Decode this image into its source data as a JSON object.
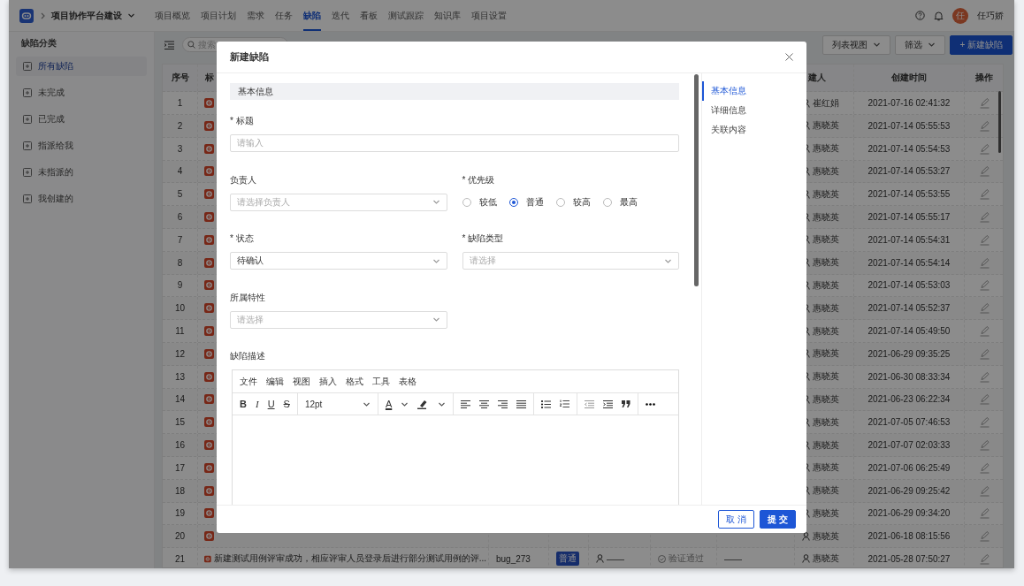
{
  "project": {
    "name": "项目协作平台建设"
  },
  "nav": [
    {
      "label": "项目概览",
      "selected": false
    },
    {
      "label": "项目计划",
      "selected": false
    },
    {
      "label": "需求",
      "selected": false
    },
    {
      "label": "任务",
      "selected": false
    },
    {
      "label": "缺陷",
      "selected": true
    },
    {
      "label": "迭代",
      "selected": false
    },
    {
      "label": "看板",
      "selected": false
    },
    {
      "label": "测试跟踪",
      "selected": false
    },
    {
      "label": "知识库",
      "selected": false
    },
    {
      "label": "项目设置",
      "selected": false
    }
  ],
  "user": {
    "avatar": "任",
    "name": "任巧娇"
  },
  "sidebar": {
    "title": "缺陷分类",
    "items": [
      {
        "label": "所有缺陷",
        "selected": true
      },
      {
        "label": "未完成",
        "selected": false
      },
      {
        "label": "已完成",
        "selected": false
      },
      {
        "label": "指派给我",
        "selected": false
      },
      {
        "label": "未指派的",
        "selected": false
      },
      {
        "label": "我创建的",
        "selected": false
      }
    ]
  },
  "toolbar": {
    "search_placeholder": "搜索",
    "buttons": [
      {
        "label": "列表视图",
        "kind": "dropdown"
      },
      {
        "label": "筛选",
        "kind": "dropdown"
      },
      {
        "label": "+ 新建缺陷",
        "kind": "primary"
      }
    ]
  },
  "table": {
    "columns": {
      "index": "序号",
      "title": "标",
      "creator": "建人",
      "created": "创建时间",
      "actions": "操作"
    },
    "rows": [
      {
        "index": "1",
        "creator": "崔红娟",
        "created": "2021-07-16 02:41:32"
      },
      {
        "index": "2",
        "creator": "惠晓英",
        "created": "2021-07-14 05:55:53"
      },
      {
        "index": "3",
        "creator": "惠晓英",
        "created": "2021-07-14 05:54:53"
      },
      {
        "index": "4",
        "creator": "惠晓英",
        "created": "2021-07-14 05:53:27"
      },
      {
        "index": "5",
        "creator": "惠晓英",
        "created": "2021-07-14 05:53:55"
      },
      {
        "index": "6",
        "creator": "惠晓英",
        "created": "2021-07-14 05:55:17"
      },
      {
        "index": "7",
        "creator": "惠晓英",
        "created": "2021-07-14 05:54:31"
      },
      {
        "index": "8",
        "creator": "惠晓英",
        "created": "2021-07-14 05:54:14"
      },
      {
        "index": "9",
        "creator": "惠晓英",
        "created": "2021-07-14 05:53:03"
      },
      {
        "index": "10",
        "creator": "惠晓英",
        "created": "2021-07-14 05:52:37"
      },
      {
        "index": "11",
        "creator": "惠晓英",
        "created": "2021-07-14 05:49:50"
      },
      {
        "index": "12",
        "creator": "惠晓英",
        "created": "2021-06-29 09:35:25"
      },
      {
        "index": "13",
        "creator": "惠晓英",
        "created": "2021-06-30 08:33:34"
      },
      {
        "index": "14",
        "creator": "惠晓英",
        "created": "2021-06-23 06:22:34"
      },
      {
        "index": "15",
        "creator": "惠晓英",
        "created": "2021-07-05 07:46:53"
      },
      {
        "index": "16",
        "creator": "惠晓英",
        "created": "2021-07-07 02:03:33"
      },
      {
        "index": "17",
        "creator": "惠晓英",
        "created": "2021-07-06 06:25:49"
      },
      {
        "index": "18",
        "creator": "惠晓英",
        "created": "2021-06-29 09:25:42"
      },
      {
        "index": "19",
        "creator": "惠晓英",
        "created": "2021-06-29 09:34:20"
      },
      {
        "index": "20",
        "creator": "惠晓英",
        "created": "2021-06-18 08:15:56"
      },
      {
        "index": "21",
        "title": "新建测试用例评审成功，相应评审人员登录后进行部分测试用例的评...",
        "id": "bug_273",
        "priority": "普通",
        "assignee": "——",
        "status": "验证通过",
        "column_8": "——",
        "creator": "惠晓英",
        "created": "2021-05-28 07:50:27"
      }
    ]
  },
  "modal": {
    "title": "新建缺陷",
    "section": "基本信息",
    "fields": [
      {
        "kind": "text",
        "label": "* 标题",
        "placeholder": "请输入"
      },
      {
        "kind": "select",
        "label": "负责人",
        "placeholder": "请选择负责人"
      },
      {
        "kind": "radio",
        "label": "* 优先级",
        "options": [
          {
            "label": "较低",
            "selected": false
          },
          {
            "label": "普通",
            "selected": true
          },
          {
            "label": "较高",
            "selected": false
          },
          {
            "label": "最高",
            "selected": false
          }
        ]
      },
      {
        "kind": "select",
        "label": "* 状态",
        "value": "待确认"
      },
      {
        "kind": "select",
        "label": "* 缺陷类型",
        "placeholder": "请选择"
      },
      {
        "kind": "select",
        "label": "所属特性",
        "placeholder": "请选择"
      },
      {
        "kind": "editor",
        "label": "缺陷描述",
        "menu": [
          "文件",
          "编辑",
          "视图",
          "插入",
          "格式",
          "工具",
          "表格"
        ],
        "format_buttons": [
          "B",
          "I",
          "U",
          "S"
        ],
        "font_size": "12pt",
        "text_color_label": "A"
      }
    ],
    "nav": [
      {
        "label": "基本信息",
        "selected": true
      },
      {
        "label": "详细信息",
        "selected": false
      },
      {
        "label": "关联内容",
        "selected": false
      }
    ],
    "buttons": [
      {
        "label": "取 消",
        "kind": "secondary"
      },
      {
        "label": "提 交",
        "kind": "primary"
      }
    ]
  }
}
